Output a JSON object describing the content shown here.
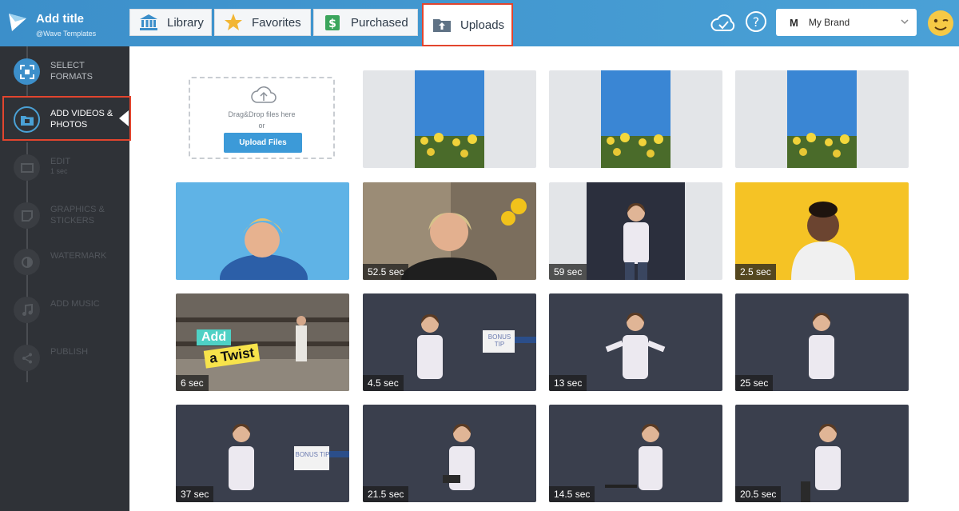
{
  "app": {
    "title": "Add title",
    "subtitle": "@Wave Templates"
  },
  "tabs": [
    {
      "label": "Library",
      "icon": "library-icon"
    },
    {
      "label": "Favorites",
      "icon": "star-icon"
    },
    {
      "label": "Purchased",
      "icon": "purchased-icon"
    },
    {
      "label": "Uploads",
      "icon": "uploads-folder-icon",
      "active": true
    }
  ],
  "header": {
    "brand_initial": "M",
    "brand_name": "My Brand"
  },
  "steps": [
    {
      "label": "SELECT FORMATS",
      "state": "done"
    },
    {
      "label": "ADD VIDEOS & PHOTOS",
      "state": "active"
    },
    {
      "label": "EDIT",
      "sub": "1 sec",
      "state": "dim"
    },
    {
      "label": "GRAPHICS & STICKERS",
      "state": "dim"
    },
    {
      "label": "WATERMARK",
      "state": "dim"
    },
    {
      "label": "ADD MUSIC",
      "state": "dim"
    },
    {
      "label": "PUBLISH",
      "state": "dim"
    }
  ],
  "upload": {
    "drop_text": "Drag&Drop files here",
    "or_text": "or",
    "button": "Upload Files"
  },
  "media": [
    {
      "duration": ""
    },
    {
      "duration": ""
    },
    {
      "duration": ""
    },
    {
      "duration": ""
    },
    {
      "duration": "52.5 sec"
    },
    {
      "duration": "59 sec"
    },
    {
      "duration": "2.5 sec"
    },
    {
      "duration": "6 sec",
      "overlay_line1": "Add",
      "overlay_line2": "a Twist"
    },
    {
      "duration": "4.5 sec",
      "sign": "BONUS TIP"
    },
    {
      "duration": "13 sec"
    },
    {
      "duration": "25 sec"
    },
    {
      "duration": "37 sec",
      "sign": "BONUS TIP"
    },
    {
      "duration": "21.5 sec"
    },
    {
      "duration": "14.5 sec"
    },
    {
      "duration": "20.5 sec"
    }
  ],
  "colors": {
    "accent": "#3c8fca",
    "highlight": "#e2452e",
    "sidebar": "#2f3237"
  }
}
